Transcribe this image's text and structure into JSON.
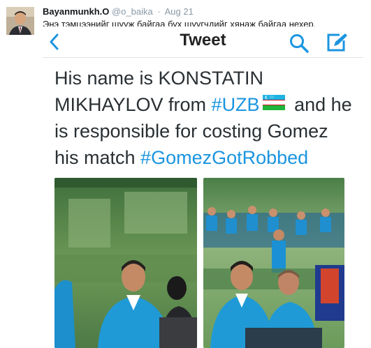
{
  "tweet": {
    "display_name": "Bayanmunkh.O",
    "handle": "@o_baika",
    "separator": "·",
    "time": "Aug 21",
    "text": "Энэ тэмцээнийг шууж байгаа бух шуугчдийг хянаж байгаа нехер."
  },
  "screenshot": {
    "nav": {
      "back_icon": "chevron-left-icon",
      "title": "Tweet",
      "search_icon": "search-icon",
      "compose_icon": "compose-icon"
    },
    "text": {
      "line1": "His name is KONSTATIN",
      "line2_prefix": "MIKHAYLOV from ",
      "hashtag_uzb": "#UZB",
      "line2_suffix": " and he",
      "line3": "is responsible for costing Gomez",
      "line4_prefix": "his match ",
      "hashtag_robbed": "#GomezGotRobbed"
    },
    "accent_color": "#1b95e0"
  }
}
